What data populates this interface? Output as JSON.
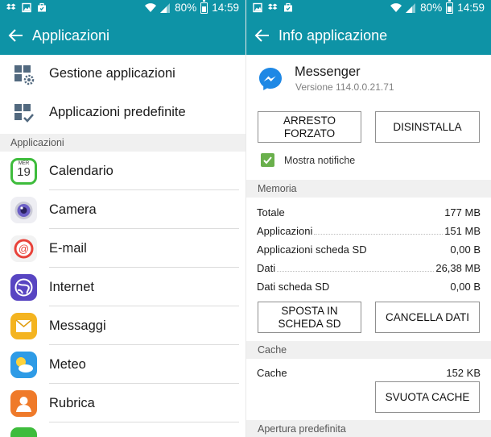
{
  "statusbar": {
    "battery": "80%",
    "time": "14:59"
  },
  "left": {
    "title": "Applicazioni",
    "settings": [
      {
        "label": "Gestione applicazioni",
        "icon": "app-manager-icon"
      },
      {
        "label": "Applicazioni predefinite",
        "icon": "default-apps-icon"
      }
    ],
    "section": "Applicazioni",
    "apps": [
      {
        "label": "Calendario",
        "icon": "calendar-icon",
        "calendar_day": "19",
        "calendar_month": "MER"
      },
      {
        "label": "Camera",
        "icon": "camera-icon"
      },
      {
        "label": "E-mail",
        "icon": "email-icon"
      },
      {
        "label": "Internet",
        "icon": "internet-icon"
      },
      {
        "label": "Messaggi",
        "icon": "messages-icon"
      },
      {
        "label": "Meteo",
        "icon": "weather-icon"
      },
      {
        "label": "Rubrica",
        "icon": "contacts-icon"
      }
    ]
  },
  "right": {
    "title": "Info applicazione",
    "app_name": "Messenger",
    "version": "Versione 114.0.0.21.71",
    "force_stop": "ARRESTO FORZATO",
    "uninstall": "DISINSTALLA",
    "show_notifications": "Mostra notifiche",
    "notifications_checked": true,
    "memory_section": "Memoria",
    "memory": [
      {
        "label": "Totale",
        "value": "177 MB"
      },
      {
        "label": "Applicazioni",
        "value": "151 MB"
      },
      {
        "label": "Applicazioni scheda SD",
        "value": "0,00 B"
      },
      {
        "label": "Dati",
        "value": "26,38 MB"
      },
      {
        "label": "Dati scheda SD",
        "value": "0,00 B"
      }
    ],
    "move_to_sd": "SPOSTA IN SCHEDA SD",
    "clear_data": "CANCELLA DATI",
    "cache_section": "Cache",
    "cache": {
      "label": "Cache",
      "value": "152 KB"
    },
    "clear_cache": "SVUOTA CACHE",
    "default_section": "Apertura predefinita"
  },
  "colors": {
    "accent": "#0e93a6",
    "messenger": "#1e88e5",
    "check": "#6ab04c"
  }
}
